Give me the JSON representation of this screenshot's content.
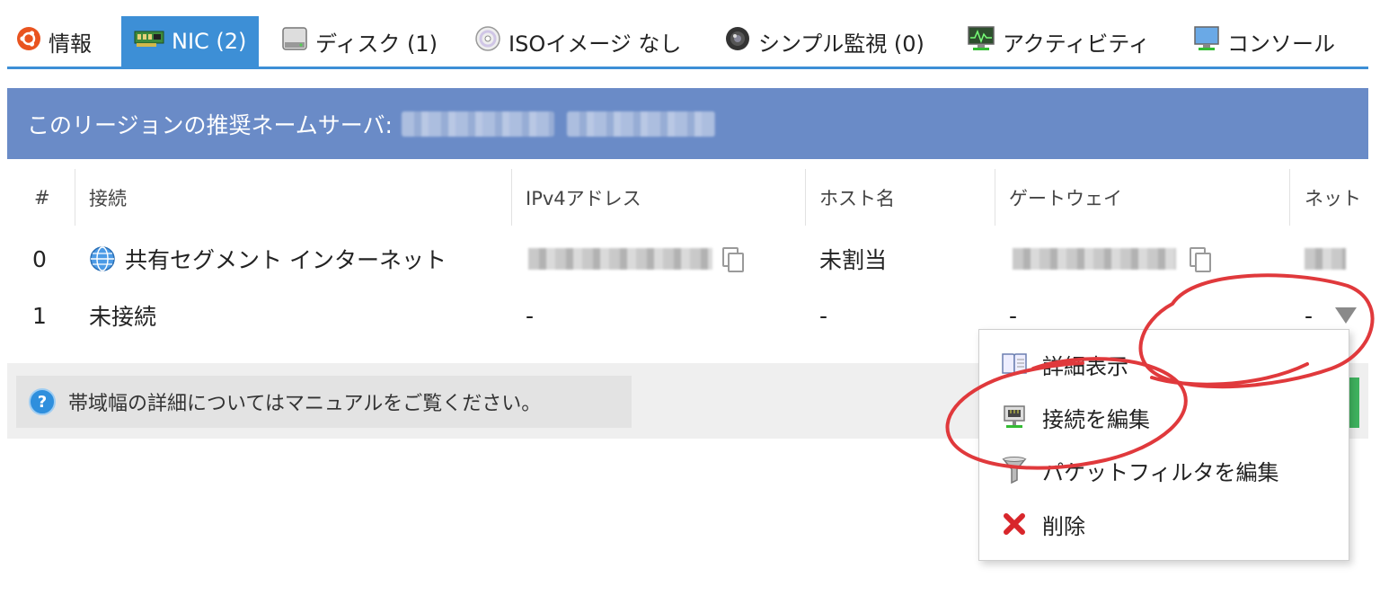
{
  "tabs": [
    {
      "label": "情報",
      "icon": "ubuntu-icon"
    },
    {
      "label": "NIC (2)",
      "icon": "nic-card-icon",
      "active": true
    },
    {
      "label": "ディスク (1)",
      "icon": "disk-icon"
    },
    {
      "label": "ISOイメージ なし",
      "icon": "cd-icon"
    },
    {
      "label": "シンプル監視 (0)",
      "icon": "monitor-lens-icon"
    },
    {
      "label": "アクティビティ",
      "icon": "activity-monitor-icon"
    },
    {
      "label": "コンソール",
      "icon": "console-icon"
    }
  ],
  "banner": {
    "label": "このリージョンの推奨ネームサーバ:"
  },
  "table": {
    "headers": [
      "#",
      "接続",
      "IPv4アドレス",
      "ホスト名",
      "ゲートウェイ",
      "ネット"
    ],
    "rows": [
      {
        "index": "0",
        "connection": "共有セグメント インターネット",
        "ipv4": "",
        "host": "未割当",
        "gateway": "",
        "net": ""
      },
      {
        "index": "1",
        "connection": "未接続",
        "ipv4": "-",
        "host": "-",
        "gateway": "-",
        "net": "-"
      }
    ]
  },
  "help": {
    "text": "帯域幅の詳細についてはマニュアルをご覧ください。"
  },
  "menu": {
    "items": [
      {
        "label": "詳細表示",
        "icon": "book-icon"
      },
      {
        "label": "接続を編集",
        "icon": "network-edit-icon"
      },
      {
        "label": "パケットフィルタを編集",
        "icon": "filter-icon"
      },
      {
        "label": "削除",
        "icon": "delete-x-icon"
      }
    ]
  },
  "colors": {
    "accent": "#3d8fd6",
    "banner": "#6a8bc7",
    "annotation": "#e0393c",
    "delete": "#d8262b"
  }
}
